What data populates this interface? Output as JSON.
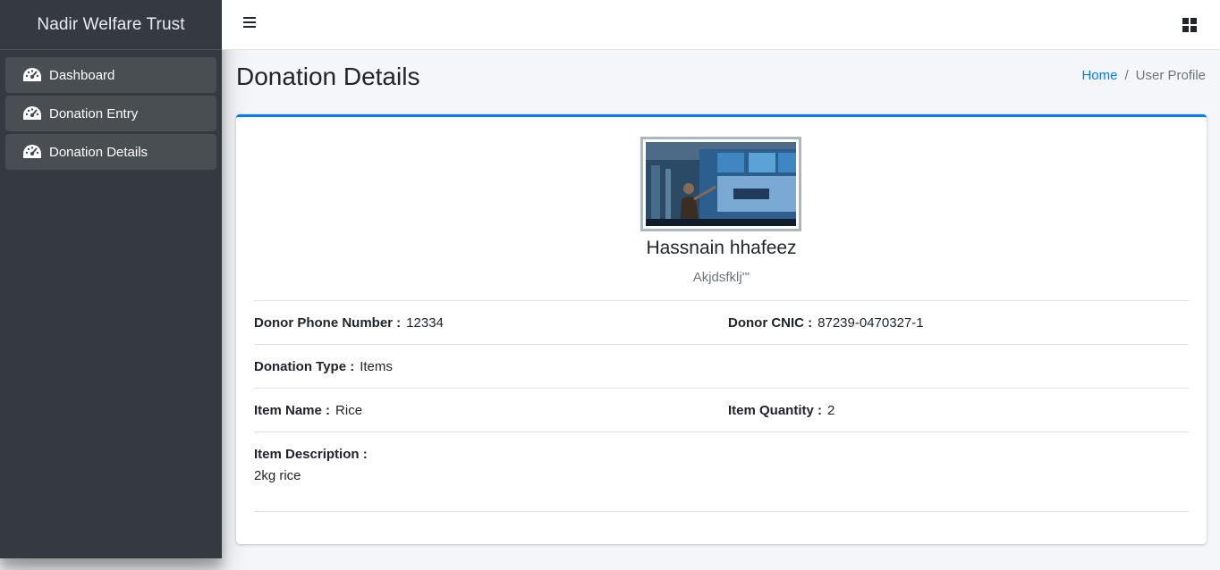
{
  "sidebar": {
    "brand": "Nadir Welfare Trust",
    "items": [
      {
        "label": "Dashboard",
        "icon": "tachometer-icon"
      },
      {
        "label": "Donation Entry",
        "icon": "tachometer-icon"
      },
      {
        "label": "Donation Details",
        "icon": "tachometer-icon"
      }
    ]
  },
  "topbar": {
    "menu_icon": "hamburger-icon",
    "apps_icon": "grid-icon"
  },
  "header": {
    "title": "Donation Details",
    "breadcrumb": {
      "home": "Home",
      "separator": "/",
      "current": "User Profile"
    }
  },
  "profile": {
    "name": "Hassnain hhafeez",
    "subtitle": "Akjdsfklj'''"
  },
  "details": {
    "phone_label": "Donor Phone Number :",
    "phone_value": "12334",
    "cnic_label": "Donor CNIC :",
    "cnic_value": "87239-0470327-1",
    "type_label": "Donation Type :",
    "type_value": "Items",
    "item_name_label": "Item Name :",
    "item_name_value": "Rice",
    "item_qty_label": "Item Quantity :",
    "item_qty_value": "2",
    "item_desc_label": "Item Description :",
    "item_desc_value": "2kg rice"
  },
  "colors": {
    "sidebar_bg": "#343a40",
    "accent": "#007bff",
    "nav_item_bg": "#494e53"
  }
}
